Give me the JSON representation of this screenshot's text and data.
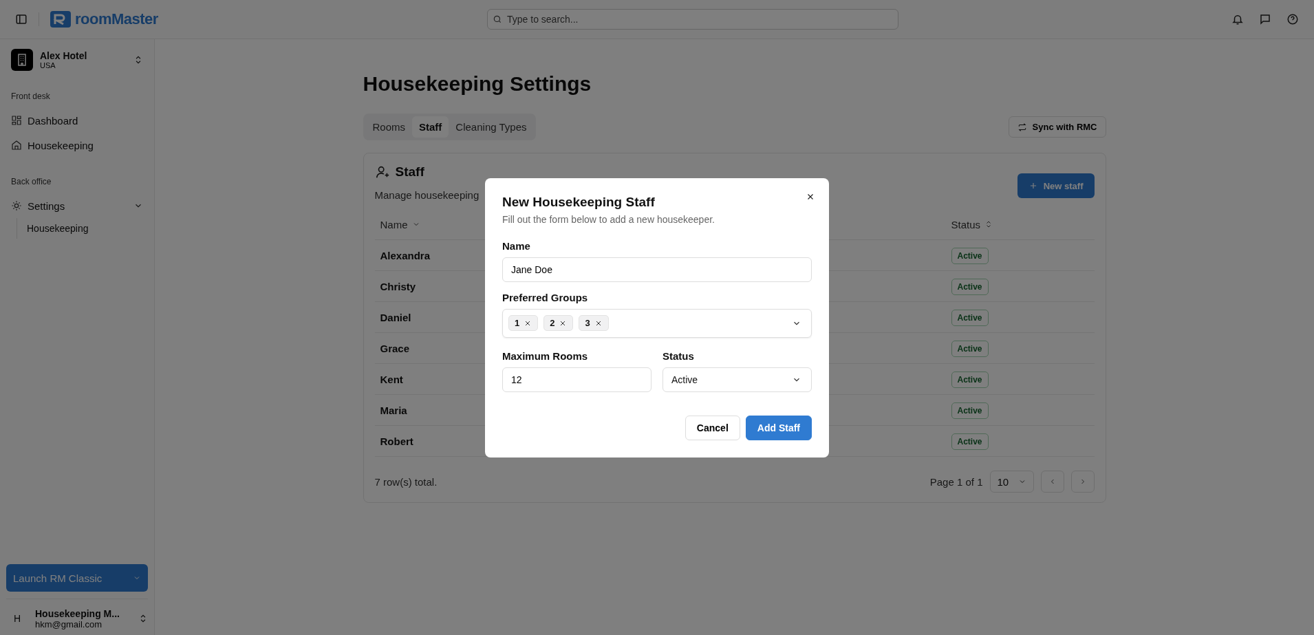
{
  "topbar": {
    "logo": "roomMaster",
    "search": {
      "placeholder": "Type to search..."
    }
  },
  "sidebar": {
    "hotel": {
      "name": "Alex Hotel",
      "country": "USA"
    },
    "sections": [
      {
        "label": "Front desk",
        "items": [
          {
            "label": "Dashboard",
            "kind": "dashboard"
          },
          {
            "label": "Housekeeping",
            "kind": "home"
          }
        ]
      },
      {
        "label": "Back office",
        "items": [
          {
            "label": "Settings",
            "kind": "settings",
            "expanded": true,
            "children": [
              {
                "label": "Housekeeping"
              }
            ]
          }
        ]
      }
    ],
    "launch_button": "Launch RM Classic",
    "user": {
      "initial": "H",
      "name": "Housekeeping M...",
      "email": "hkm@gmail.com"
    }
  },
  "page": {
    "title": "Housekeeping Settings",
    "tabs": [
      {
        "label": "Rooms",
        "selected": false
      },
      {
        "label": "Staff",
        "selected": true
      },
      {
        "label": "Cleaning Types",
        "selected": false
      }
    ],
    "sync_button": "Sync with RMC"
  },
  "card": {
    "title": "Staff",
    "description": "Manage housekeeping",
    "new_button": "New staff",
    "columns": [
      {
        "label": "Name",
        "sorted": true
      },
      {
        "label": "Status",
        "sorted": false
      }
    ],
    "rows": [
      {
        "name": "Alexandra",
        "status": "Active"
      },
      {
        "name": "Christy",
        "status": "Active"
      },
      {
        "name": "Daniel",
        "status": "Active"
      },
      {
        "name": "Grace",
        "status": "Active"
      },
      {
        "name": "Kent",
        "status": "Active"
      },
      {
        "name": "Maria",
        "status": "Active"
      },
      {
        "name": "Robert",
        "status": "Active"
      }
    ],
    "total": "7 row(s) total.",
    "page_info": "Page 1 of 1",
    "page_size": "10"
  },
  "dialog": {
    "title": "New Housekeeping Staff",
    "description": "Fill out the form below to add a new housekeeper.",
    "name_field": {
      "label": "Name",
      "value": "Jane Doe"
    },
    "groups_field": {
      "label": "Preferred Groups",
      "tags": [
        "1",
        "2",
        "3"
      ]
    },
    "rooms_field": {
      "label": "Maximum Rooms",
      "value": "12"
    },
    "status_field": {
      "label": "Status",
      "value": "Active"
    },
    "buttons": [
      {
        "label": "Cancel",
        "kind": "secondary"
      },
      {
        "label": "Add Staff",
        "kind": "primary"
      }
    ]
  }
}
